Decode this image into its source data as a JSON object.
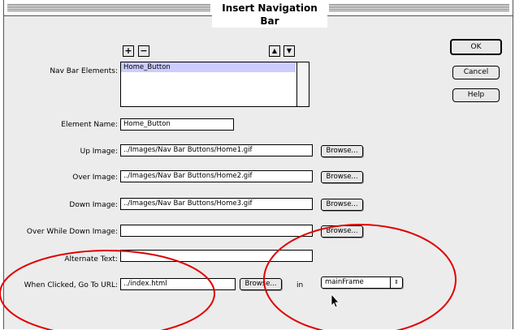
{
  "dialog": {
    "title": "Insert Navigation Bar"
  },
  "buttons": {
    "ok": "OK",
    "cancel": "Cancel",
    "help": "Help"
  },
  "toolbar": {
    "add": "+",
    "remove": "−",
    "up": "▲",
    "down": "▼"
  },
  "nav_elements": {
    "label": "Nav Bar Elements:",
    "items": [
      "Home_Button"
    ]
  },
  "element_name": {
    "label": "Element Name:",
    "value": "Home_Button"
  },
  "up_image": {
    "label": "Up Image:",
    "value": "../Images/Nav Bar Buttons/Home1.gif",
    "browse": "Browse..."
  },
  "over_image": {
    "label": "Over Image:",
    "value": "../Images/Nav Bar Buttons/Home2.gif",
    "browse": "Browse..."
  },
  "down_image": {
    "label": "Down Image:",
    "value": "../Images/Nav Bar Buttons/Home3.gif",
    "browse": "Browse..."
  },
  "over_while_down": {
    "label": "Over While Down Image:",
    "value": "",
    "browse": "Browse..."
  },
  "alternate_text": {
    "label": "Alternate Text:",
    "value": ""
  },
  "go_to_url": {
    "label": "When Clicked, Go To URL:",
    "value": "../index.html",
    "browse": "Browse...",
    "in_label": "in",
    "target": "mainFrame"
  },
  "annotation_color": "#e00000"
}
